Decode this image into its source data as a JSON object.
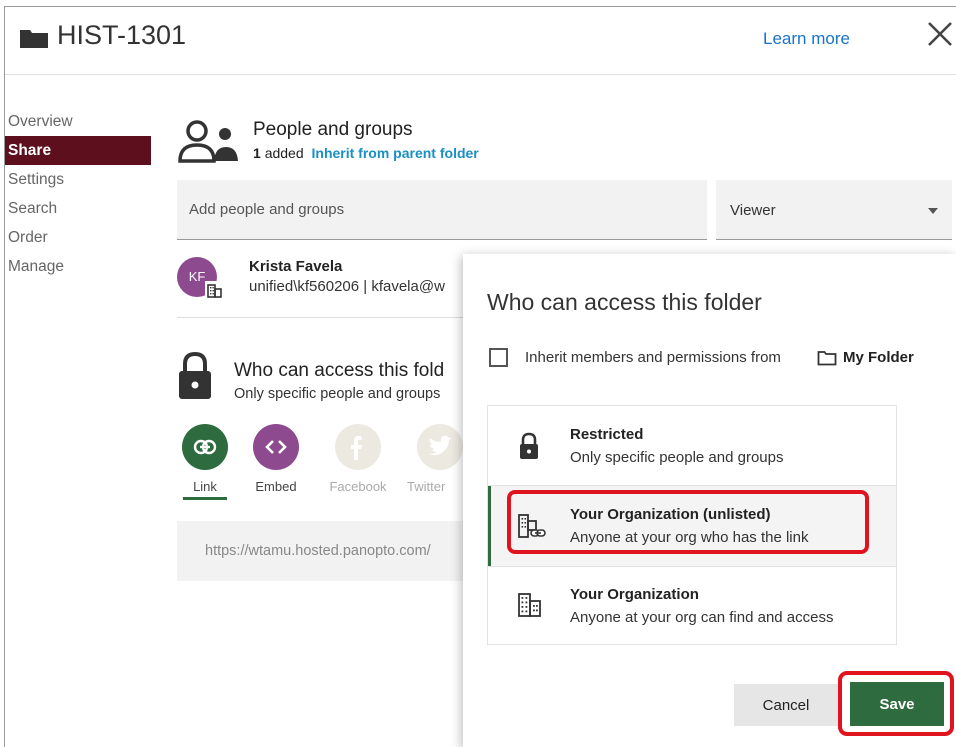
{
  "header": {
    "title": "HIST-1301",
    "learn_more": "Learn more"
  },
  "sidenav": {
    "items": [
      {
        "label": "Overview",
        "active": false
      },
      {
        "label": "Share",
        "active": true
      },
      {
        "label": "Settings",
        "active": false
      },
      {
        "label": "Search",
        "active": false
      },
      {
        "label": "Order",
        "active": false
      },
      {
        "label": "Manage",
        "active": false
      }
    ]
  },
  "people": {
    "title": "People and groups",
    "count": "1",
    "added_label": "added",
    "inherit_link": "Inherit from parent folder",
    "add_placeholder": "Add people and groups",
    "role": "Viewer",
    "user": {
      "initials": "KF",
      "name": "Krista Favela",
      "detail": "unified\\kf560206 | kfavela@w"
    }
  },
  "access": {
    "title": "Who can access this fold",
    "subtitle": "Only specific people and groups"
  },
  "share_options": [
    {
      "label": "Link",
      "icon": "link-icon",
      "color": "#2e6b3e"
    },
    {
      "label": "Embed",
      "icon": "embed-code-icon",
      "color": "#8e4a8e"
    },
    {
      "label": "Facebook",
      "icon": "facebook-icon",
      "color": "#ece9e1"
    },
    {
      "label": "Twitter",
      "icon": "twitter-icon",
      "color": "#ece9e1"
    }
  ],
  "share_url": "https://wtamu.hosted.panopto.com/",
  "modal": {
    "title": "Who can access this folder",
    "inherit_text": "Inherit members and permissions from",
    "inherit_folder": "My Folder",
    "options": [
      {
        "title": "Restricted",
        "desc": "Only specific people and groups",
        "icon": "lock-icon",
        "selected": false
      },
      {
        "title": "Your Organization (unlisted)",
        "desc": "Anyone at your org who has the link",
        "icon": "org-link-icon",
        "selected": true
      },
      {
        "title": "Your Organization",
        "desc": "Anyone at your org can find and access",
        "icon": "org-building-icon",
        "selected": false
      }
    ],
    "cancel_label": "Cancel",
    "save_label": "Save"
  },
  "colors": {
    "accent_green": "#2e6b3e",
    "nav_active": "#5d0f1e",
    "link_blue": "#1a73c8",
    "highlight_red": "#e0141e"
  }
}
